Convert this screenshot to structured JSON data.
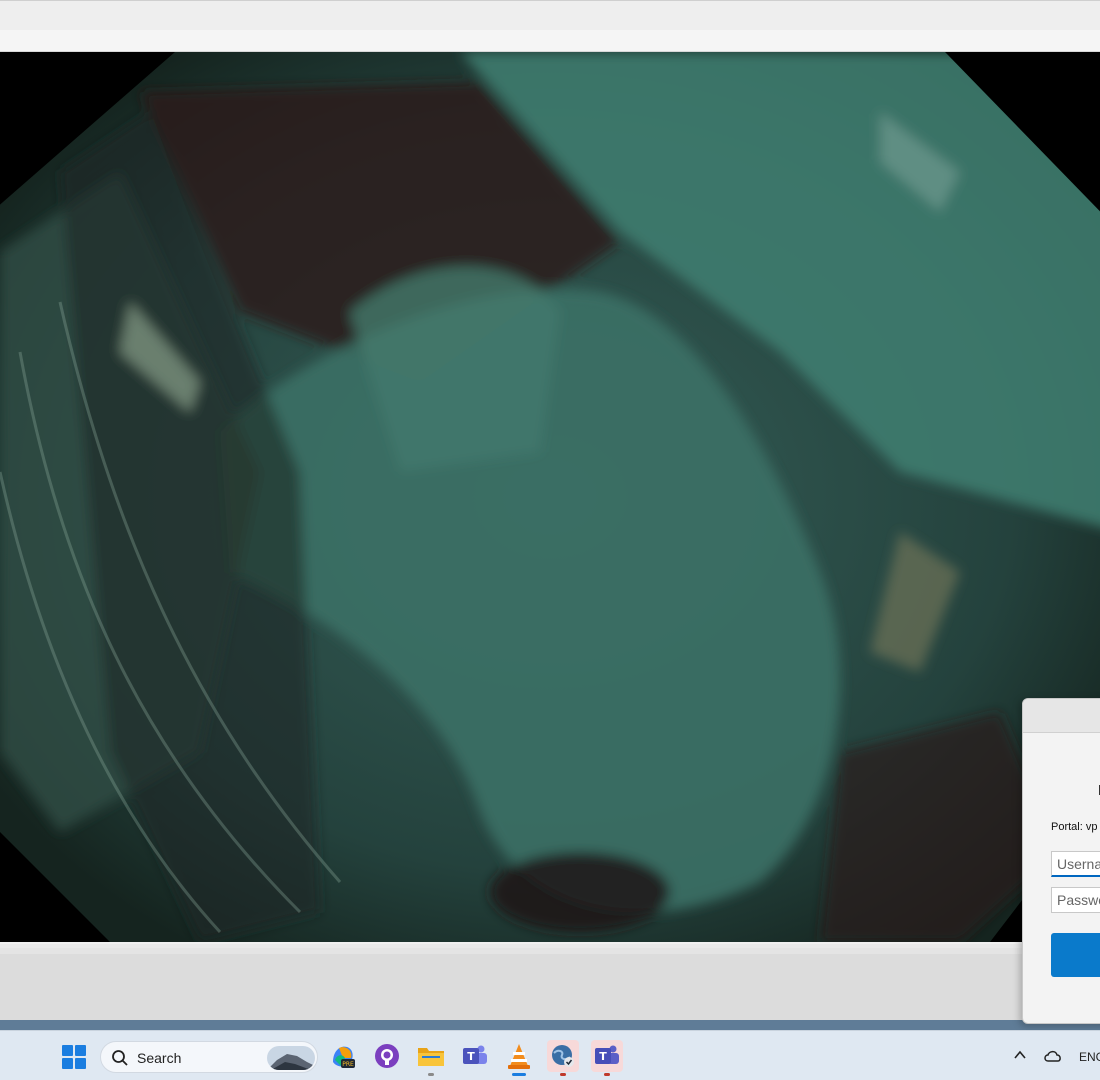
{
  "login_dialog": {
    "portal_label": "Portal: vp",
    "username_placeholder": "Userna",
    "password_placeholder": "Passwo"
  },
  "taskbar": {
    "search_label": "Search",
    "pinned_apps": [
      "copilot-icon",
      "github-desktop-icon",
      "file-explorer-icon",
      "teams-icon",
      "vlc-icon",
      "vpn-globe-icon",
      "teams-work-icon"
    ],
    "language": "ENG"
  },
  "colors": {
    "accent": "#0a7acb",
    "windows_blue": "#1a7de0",
    "video_tint": "#2f5a52"
  }
}
